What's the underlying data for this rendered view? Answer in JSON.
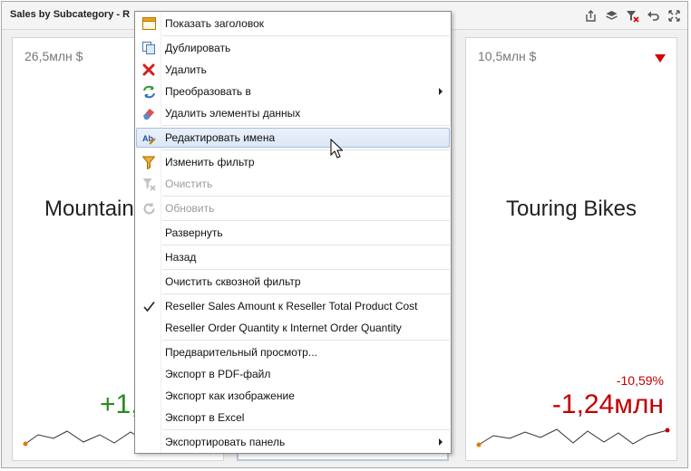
{
  "header": {
    "title": "Sales by Subcategory - R"
  },
  "cards": [
    {
      "value": "26,5млн $",
      "name": "Mountain",
      "delta": "+1,",
      "delta_type": "positive"
    },
    {
      "value": "10,5млн $",
      "name": "Touring Bikes",
      "percent": "-10,59%",
      "delta": "-1,24млн",
      "delta_type": "negative"
    }
  ],
  "context_menu": {
    "items": [
      {
        "label": "Показать заголовок",
        "icon": "caption-icon"
      },
      {
        "label": "Дублировать",
        "icon": "duplicate-icon"
      },
      {
        "label": "Удалить",
        "icon": "delete-icon"
      },
      {
        "label": "Преобразовать в",
        "icon": "convert-icon",
        "submenu": true
      },
      {
        "label": "Удалить элементы данных",
        "icon": "eraser-icon"
      },
      {
        "label": "Редактировать имена",
        "icon": "rename-icon",
        "highlighted": true
      },
      {
        "label": "Изменить фильтр",
        "icon": "filter-icon"
      },
      {
        "label": "Очистить",
        "icon": "clear-filter-icon",
        "disabled": true
      },
      {
        "label": "Обновить",
        "icon": "refresh-icon",
        "disabled": true
      },
      {
        "label": "Развернуть"
      },
      {
        "label": "Назад"
      },
      {
        "label": "Очистить сквозной фильтр"
      },
      {
        "label": "Reseller Sales Amount к Reseller Total Product Cost",
        "checked": true
      },
      {
        "label": "Reseller Order Quantity к Internet Order Quantity"
      },
      {
        "label": "Предварительный просмотр..."
      },
      {
        "label": "Экспорт в PDF-файл"
      },
      {
        "label": "Экспорт как изображение"
      },
      {
        "label": "Экспорт в Excel"
      },
      {
        "label": "Экспортировать панель",
        "submenu": true
      }
    ]
  },
  "colors": {
    "positive": "#2a8a1e",
    "negative": "#c00000",
    "sparkline": "#333333",
    "start_marker": "#e07b00",
    "highlight": "#dbe7f7"
  }
}
